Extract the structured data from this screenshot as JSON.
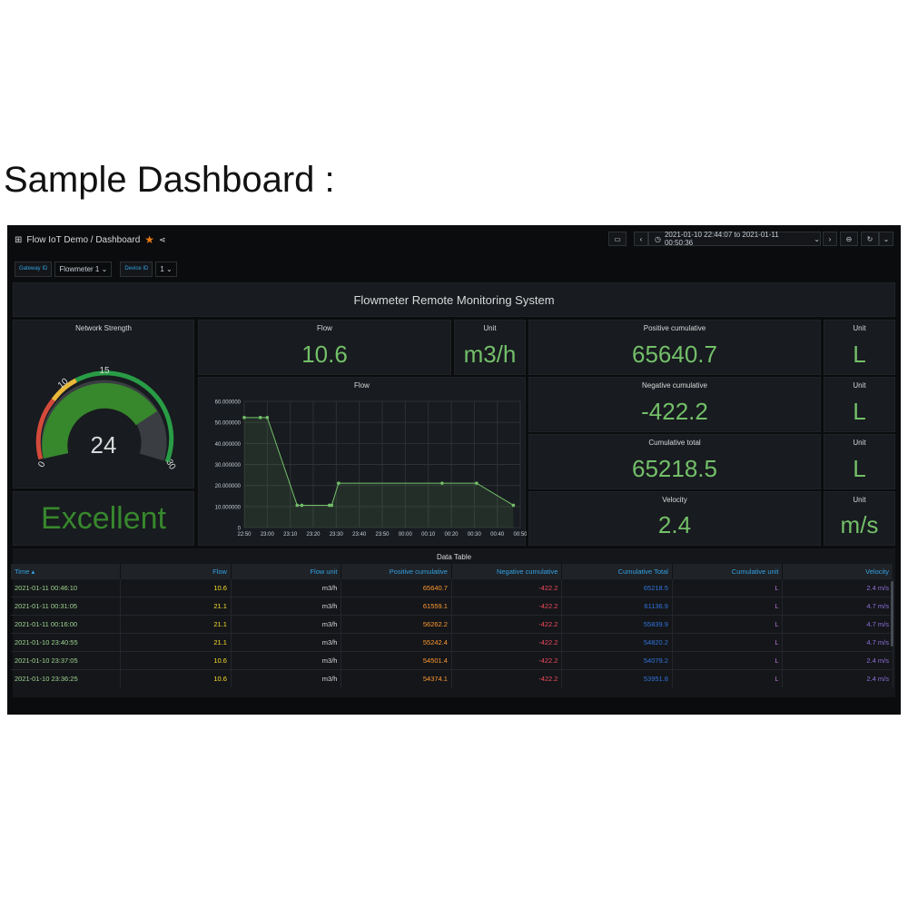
{
  "heading": "Sample Dashboard :",
  "topbar": {
    "breadcrumb": "Flow IoT Demo / Dashboard",
    "time_range": "2021-01-10 22:44:07 to 2021-01-11 00:50:36"
  },
  "variables": [
    {
      "label": "Gateway ID",
      "value": "Flowmeter 1"
    },
    {
      "label": "Device ID",
      "value": "1"
    }
  ],
  "banner": {
    "title": "Flowmeter Remote Monitoring System"
  },
  "gauge": {
    "title": "Network Strength",
    "value": "24",
    "min": 0,
    "max": 30,
    "ticks": [
      "0",
      "10",
      "15",
      "30"
    ],
    "thresholds": {
      "red_below": 10,
      "yellow_below": 15
    }
  },
  "status": {
    "text": "Excellent"
  },
  "stats": {
    "flow": {
      "title": "Flow",
      "value": "10.6"
    },
    "flow_unit": {
      "title": "Unit",
      "value": "m3/h"
    },
    "positive": {
      "title": "Positive cumulative",
      "value": "65640.7"
    },
    "positive_unit": {
      "title": "Unit",
      "value": "L"
    },
    "negative": {
      "title": "Negative cumulative",
      "value": "-422.2"
    },
    "negative_unit": {
      "title": "Unit",
      "value": "L"
    },
    "total": {
      "title": "Cumulative total",
      "value": "65218.5"
    },
    "total_unit": {
      "title": "Unit",
      "value": "L"
    },
    "velocity": {
      "title": "Velocity",
      "value": "2.4"
    },
    "velocity_unit": {
      "title": "Unit",
      "value": "m/s"
    }
  },
  "colors": {
    "accent_green": "#73bf69",
    "panel_bg": "#181b1f",
    "dash_bg": "#0b0c0e",
    "link_blue": "#33a2e5"
  },
  "chart_data": {
    "type": "area",
    "title": "Flow",
    "x": [
      "22:50",
      "23:00",
      "23:10",
      "23:20",
      "23:30",
      "23:40",
      "23:50",
      "00:00",
      "00:10",
      "00:20",
      "00:30",
      "00:40",
      "00:50"
    ],
    "ytick_labels": [
      "0",
      "10.000000",
      "20.000000",
      "30.000000",
      "40.000000",
      "50.000000",
      "60.000000"
    ],
    "ylim": [
      0,
      60
    ],
    "xlim_minutes": [
      0,
      120
    ],
    "points": [
      {
        "t": 0,
        "y": 52.3
      },
      {
        "t": 7,
        "y": 52.3
      },
      {
        "t": 10,
        "y": 52.3
      },
      {
        "t": 23,
        "y": 10.6
      },
      {
        "t": 25,
        "y": 10.6
      },
      {
        "t": 37,
        "y": 10.6
      },
      {
        "t": 38,
        "y": 10.6
      },
      {
        "t": 41,
        "y": 21.1
      },
      {
        "t": 86,
        "y": 21.1
      },
      {
        "t": 101,
        "y": 21.1
      },
      {
        "t": 117,
        "y": 10.6
      }
    ],
    "grid": true,
    "color": "#73bf69"
  },
  "table": {
    "title": "Data Table",
    "columns": [
      "Time ▴",
      "Flow",
      "Flow unit",
      "Positive cumulative",
      "Negative cumulative",
      "Cumulative Total",
      "Cumulative unit",
      "Velocity"
    ],
    "rows": [
      [
        "2021-01-11 00:46:10",
        "10.6",
        "m3/h",
        "65640.7",
        "-422.2",
        "65218.5",
        "L",
        "2.4 m/s"
      ],
      [
        "2021-01-11 00:31:05",
        "21.1",
        "m3/h",
        "61559.1",
        "-422.2",
        "61136.9",
        "L",
        "4.7 m/s"
      ],
      [
        "2021-01-11 00:16:00",
        "21.1",
        "m3/h",
        "56262.2",
        "-422.2",
        "55839.9",
        "L",
        "4.7 m/s"
      ],
      [
        "2021-01-10 23:40:55",
        "21.1",
        "m3/h",
        "55242.4",
        "-422.2",
        "54820.2",
        "L",
        "4.7 m/s"
      ],
      [
        "2021-01-10 23:37:05",
        "10.6",
        "m3/h",
        "54501.4",
        "-422.2",
        "54079.2",
        "L",
        "2.4 m/s"
      ],
      [
        "2021-01-10 23:36:25",
        "10.6",
        "m3/h",
        "54374.1",
        "-422.2",
        "53951.8",
        "L",
        "2.4 m/s"
      ]
    ]
  }
}
